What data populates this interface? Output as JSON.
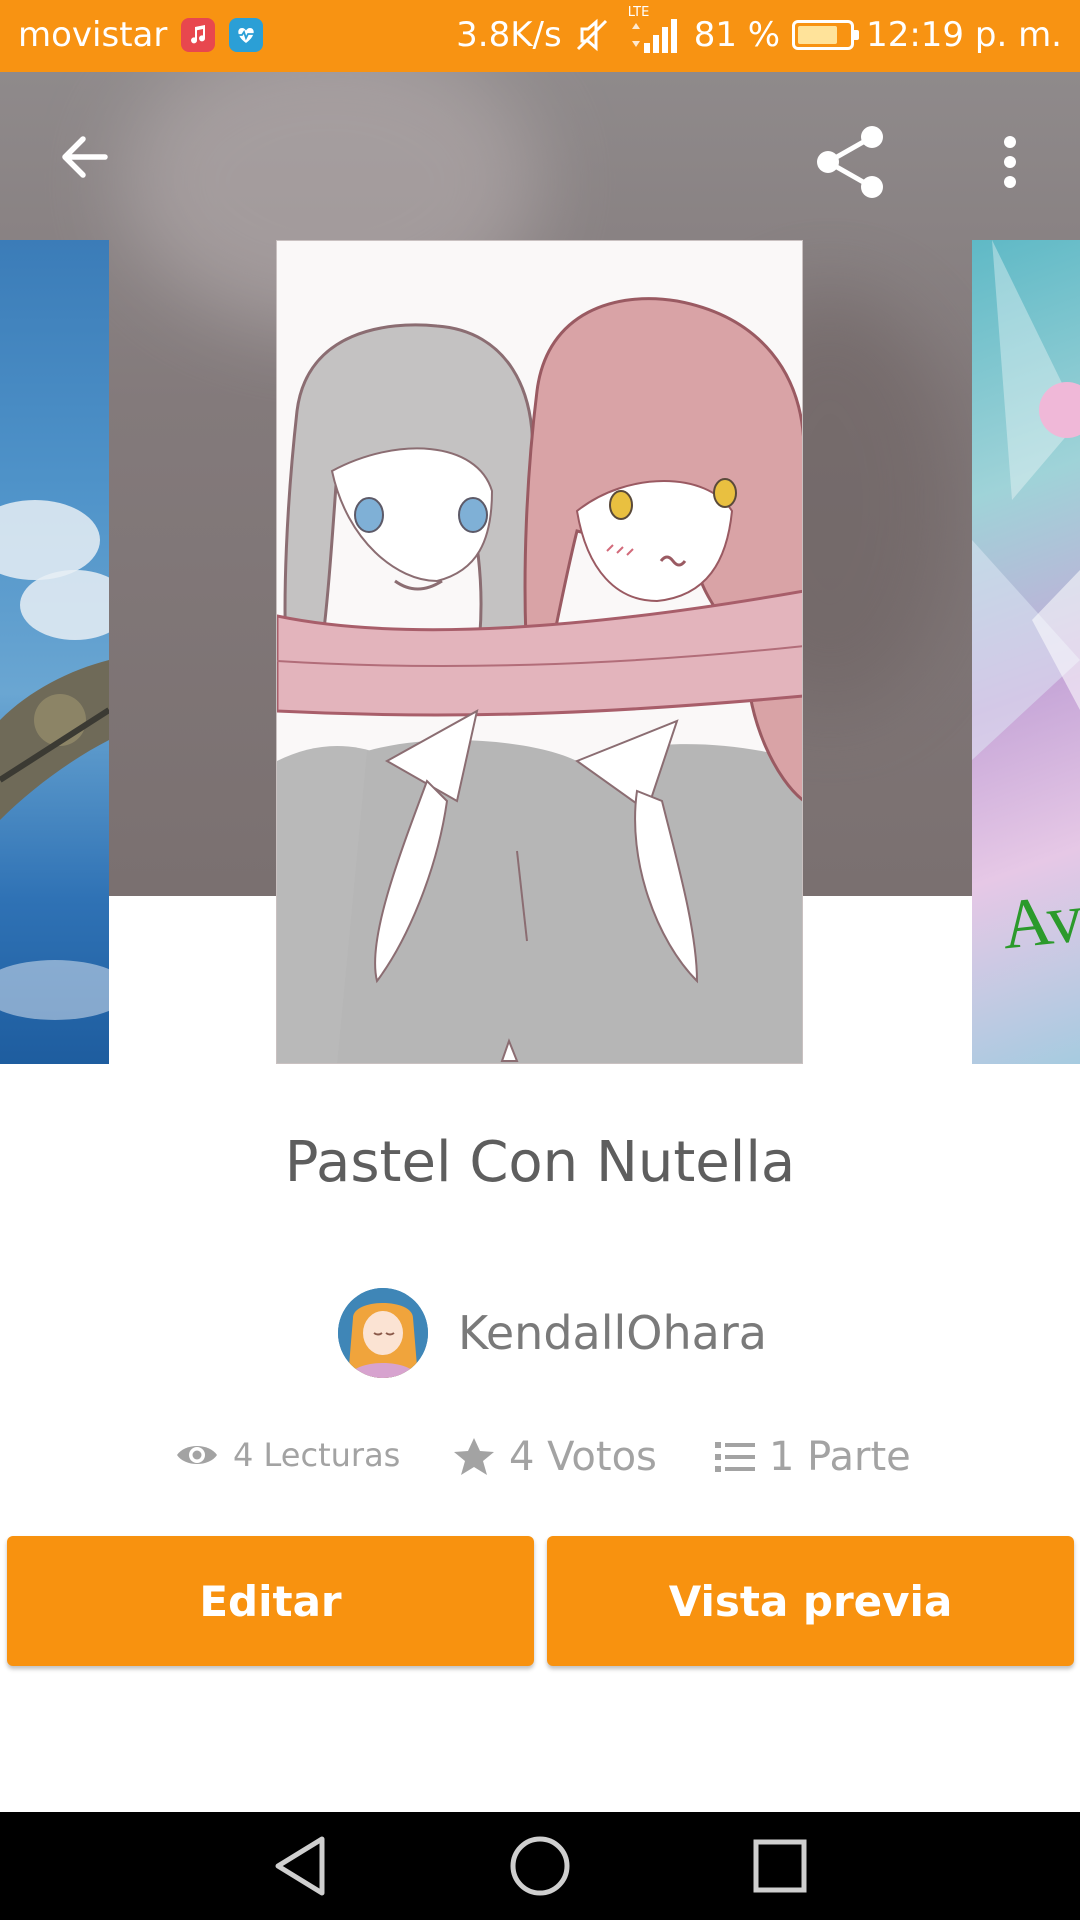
{
  "status_bar": {
    "carrier": "movistar",
    "net_speed": "3.8K/s",
    "network_type": "LTE",
    "battery_percent": "81 %",
    "battery_level": 0.81,
    "time": "12:19 p. m.",
    "icons": [
      "music-app-icon",
      "health-app-icon",
      "muted-icon",
      "signal-icon",
      "battery-icon"
    ],
    "color": "#f89312"
  },
  "toolbar": {
    "back_icon": "arrow-left-icon",
    "share_icon": "share-icon",
    "more_icon": "more-vertical-icon"
  },
  "story": {
    "title": "Pastel Con Nutella",
    "author": "KendallOhara",
    "reads": "4 Lecturas",
    "votes": "4 Votos",
    "parts": "1 Parte"
  },
  "actions": {
    "edit_label": "Editar",
    "preview_label": "Vista previa",
    "accent": "#f8920f"
  },
  "covers": {
    "right_cover_text": "Avis"
  },
  "nav_bar": {
    "icons": [
      "back-triangle-icon",
      "home-circle-icon",
      "recents-square-icon"
    ]
  }
}
